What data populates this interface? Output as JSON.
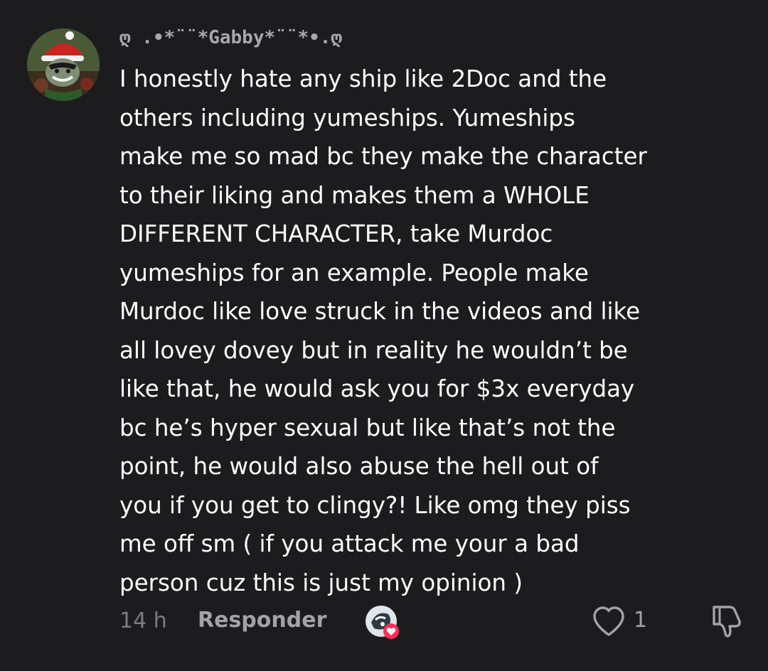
{
  "comment": {
    "username": "ღ .•*¨¨*Gabby*¨¨*•.ღ",
    "body_lines": [
      "I honestly hate any ship like 2Doc and the",
      "others including yumeships. Yumeships",
      "make me so mad bc they make the character",
      "to their liking and makes them a WHOLE",
      "DIFFERENT CHARACTER, take Murdoc",
      "yumeships for an example. People make",
      "Murdoc like love struck in the videos and like",
      "all lovey dovey but in reality he wouldn’t be",
      "like that, he would ask you for $3x everyday",
      "bc he’s hyper sexual but like that’s not the",
      "point, he would also abuse the hell out of",
      "you if you get to clingy?! Like omg they piss",
      "me off sm ( if you attack me your a bad",
      "person cuz this is just my opinion )"
    ],
    "time": "14 h",
    "reply_label": "Responder",
    "like_count": "1"
  },
  "icons": {
    "avatar": "user-avatar",
    "reactor": "creator-liked-avatar",
    "like": "heart-outline-icon",
    "dislike": "thumbs-down-outline-icon"
  },
  "colors": {
    "background": "#1c1c1e",
    "text": "#ffffff",
    "muted": "#7c7c80",
    "secondary": "#a3a3a6",
    "heart_badge": "#fe2c55"
  }
}
